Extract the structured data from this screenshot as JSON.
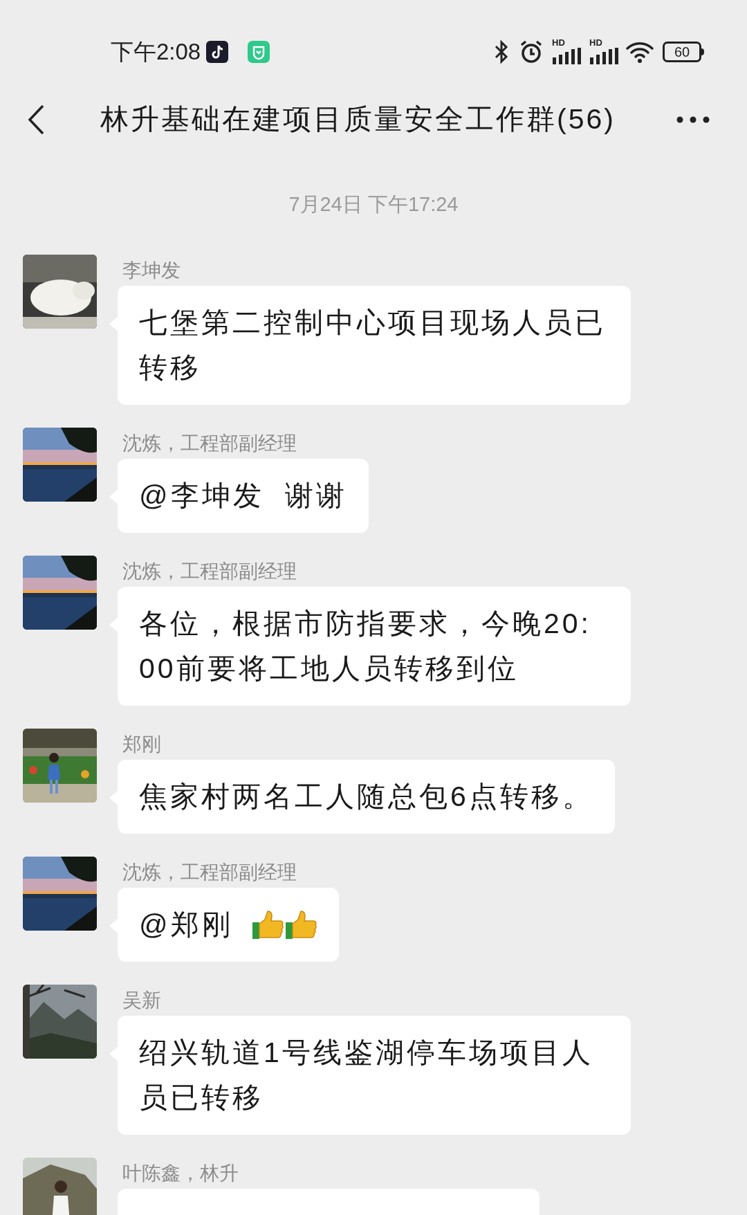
{
  "status_bar": {
    "time": "下午2:08",
    "signal_labels": [
      "HD",
      "HD"
    ],
    "battery": "60"
  },
  "header": {
    "title": "林升基础在建项目质量安全工作群(56)"
  },
  "date": "7月24日 下午17:24",
  "messages": [
    {
      "sender": "李坤发",
      "kind": "text",
      "text": "七堡第二控制中心项目现场人员已转移"
    },
    {
      "sender": "沈炼，工程部副经理",
      "kind": "text",
      "text": "@李坤发  谢谢"
    },
    {
      "sender": "沈炼，工程部副经理",
      "kind": "text",
      "text": "各位，根据市防指要求，今晚20:00前要将工地人员转移到位"
    },
    {
      "sender": "郑刚",
      "kind": "text",
      "text": "焦家村两名工人随总包6点转移。"
    },
    {
      "sender": "沈炼，工程部副经理",
      "kind": "thumbs",
      "text": "@郑刚"
    },
    {
      "sender": "吴新",
      "kind": "text",
      "text": "绍兴轨道1号线鉴湖停车场项目人员已转移"
    },
    {
      "sender": "叶陈鑫，林升",
      "kind": "text"
    }
  ]
}
